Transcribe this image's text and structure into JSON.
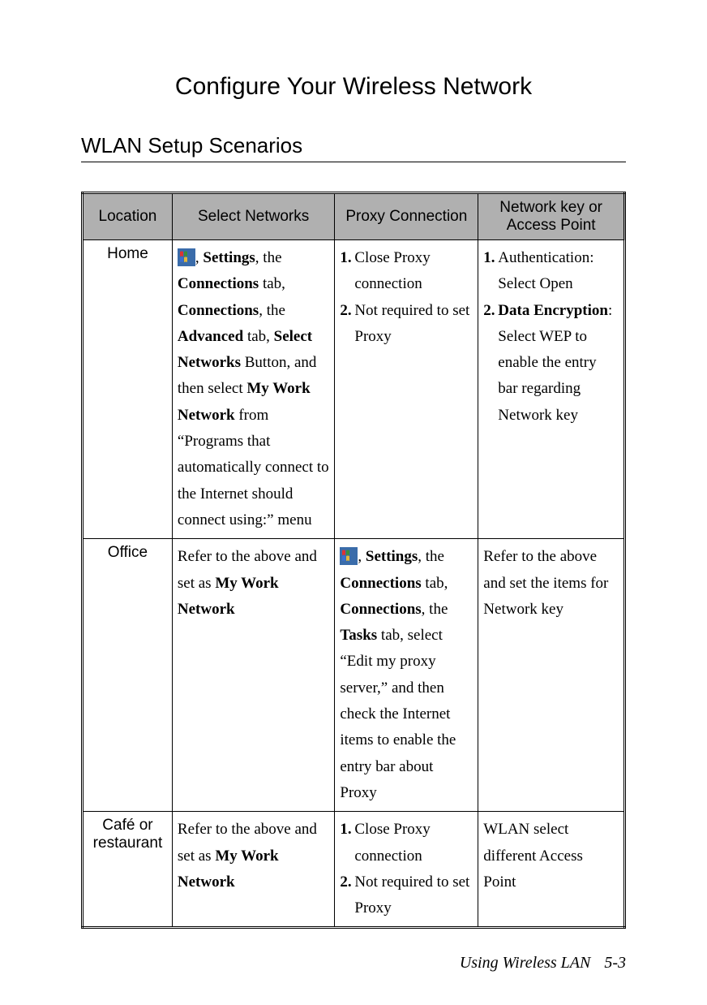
{
  "title": "Configure Your Wireless Network",
  "section": "WLAN Setup Scenarios",
  "headers": {
    "location": "Location",
    "select_networks": "Select Networks",
    "proxy_connection": "Proxy Connection",
    "network_key": "Network key or Access Point"
  },
  "rows": [
    {
      "location": "Home",
      "select_networks": {
        "has_icon": true,
        "segments": [
          {
            "t": ", "
          },
          {
            "t": "Settings",
            "b": true
          },
          {
            "t": ", the "
          },
          {
            "t": "Connections",
            "b": true
          },
          {
            "t": " tab, "
          },
          {
            "t": "Connections",
            "b": true
          },
          {
            "t": ", the "
          },
          {
            "t": "Advanced",
            "b": true
          },
          {
            "t": " tab, "
          },
          {
            "t": "Select Networks",
            "b": true
          },
          {
            "t": " Button, and then select "
          },
          {
            "t": "My Work Network",
            "b": true
          },
          {
            "t": " from “Programs that automatically connect to the Internet should connect using:” menu"
          }
        ]
      },
      "proxy_connection": {
        "type": "list",
        "items": [
          "Close Proxy connection",
          "Not required to set Proxy"
        ]
      },
      "network_key": {
        "type": "list_rich",
        "items": [
          {
            "segments": [
              {
                "t": "Authentication: Select Open"
              }
            ]
          },
          {
            "segments": [
              {
                "t": "Data Encryption",
                "b": true
              },
              {
                "t": ": Select WEP to enable the entry bar regarding Network key"
              }
            ]
          }
        ]
      }
    },
    {
      "location": "Office",
      "select_networks": {
        "has_icon": false,
        "segments": [
          {
            "t": "Refer to the above and set as "
          },
          {
            "t": "My Work Network",
            "b": true
          }
        ]
      },
      "proxy_connection": {
        "type": "rich",
        "has_icon": true,
        "segments": [
          {
            "t": ", "
          },
          {
            "t": "Settings",
            "b": true
          },
          {
            "t": ", the "
          },
          {
            "t": "Connections",
            "b": true
          },
          {
            "t": " tab, "
          },
          {
            "t": "Connections",
            "b": true
          },
          {
            "t": ", the "
          },
          {
            "t": "Tasks",
            "b": true
          },
          {
            "t": " tab, select “Edit my proxy server,” and then check the Internet items to enable the entry bar about Proxy"
          }
        ]
      },
      "network_key": {
        "type": "plain",
        "text": "Refer to the above and set the items for Network key"
      }
    },
    {
      "location": "Café or restaurant",
      "select_networks": {
        "has_icon": false,
        "segments": [
          {
            "t": "Refer to the above and set as "
          },
          {
            "t": "My Work Network",
            "b": true
          }
        ]
      },
      "proxy_connection": {
        "type": "list",
        "items": [
          "Close Proxy connection",
          "Not required to set Proxy"
        ]
      },
      "network_key": {
        "type": "plain",
        "text": "WLAN select different Access Point"
      }
    }
  ],
  "footer": {
    "text": "Using Wireless LAN",
    "page": "5-3"
  }
}
